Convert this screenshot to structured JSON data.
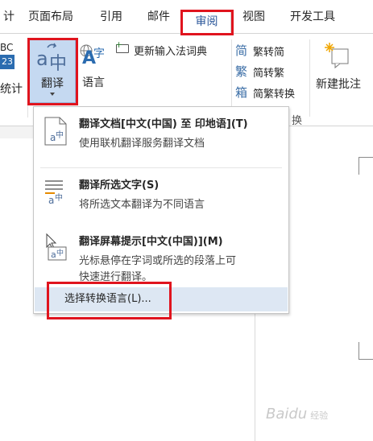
{
  "tabs": [
    {
      "label": "计"
    },
    {
      "label": "页面布局"
    },
    {
      "label": "引用"
    },
    {
      "label": "邮件"
    },
    {
      "label": "审阅"
    },
    {
      "label": "视图"
    },
    {
      "label": "开发工具"
    }
  ],
  "ribbon": {
    "stats_top": "BC",
    "stats_num": "23",
    "stats_label": "统计",
    "translate_label": "翻译",
    "language_label": "语言",
    "update_ime_label": "更新输入法词典",
    "trad_label": "繁转简",
    "simp_label": "简转繁",
    "convert_label": "简繁转换",
    "group_label_partial": "换",
    "new_comment_label": "新建批注",
    "translate_glyph_a": "a",
    "translate_glyph_zh": "中",
    "language_glyph_a": "A",
    "language_glyph_zh": "字",
    "trad_glyph": "简",
    "simp_glyph": "繁",
    "convert_glyph": "箱"
  },
  "menu": {
    "items": [
      {
        "title": "翻译文档[中文(中国) 至 印地语](T)",
        "desc": "使用联机翻译服务翻译文档"
      },
      {
        "title": "翻译所选文字(S)",
        "desc": "将所选文本翻译为不同语言"
      },
      {
        "title": "翻译屏幕提示[中文(中国)](M)",
        "desc": "光标悬停在字词或所选的段落上可",
        "desc2": "快速进行翻译。"
      }
    ],
    "footer": "选择转换语言(L)..."
  },
  "watermark": {
    "text": "Baidu",
    "sub": "经验"
  },
  "colors": {
    "accent": "#2b579a",
    "highlight": "#e0141e",
    "hover": "#dde7f3"
  }
}
